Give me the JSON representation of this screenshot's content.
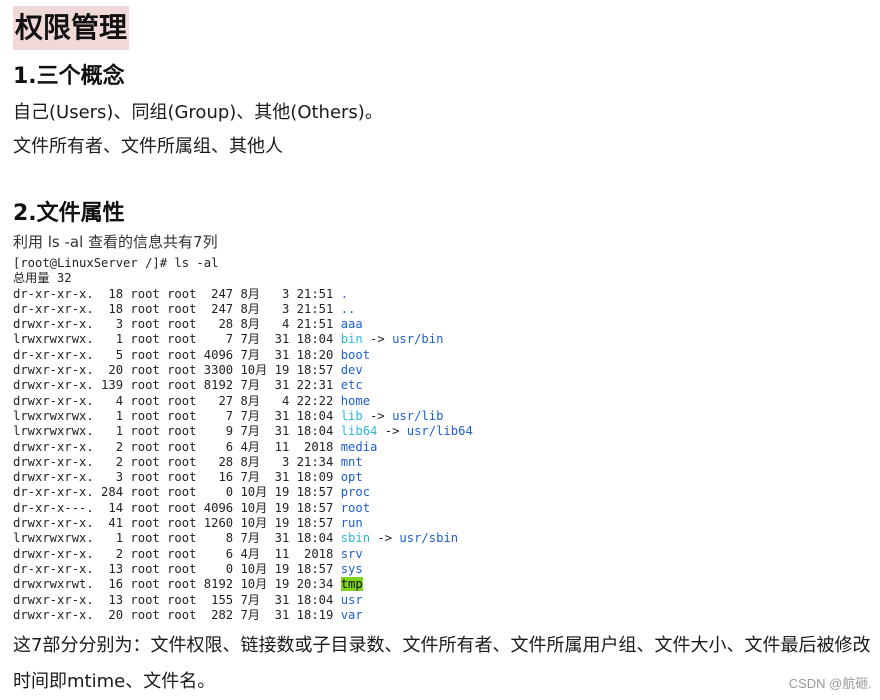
{
  "title": "权限管理",
  "section1": {
    "heading": "1.三个概念",
    "line1": "自己(Users)、同组(Group)、其他(Others)。",
    "line2": "文件所有者、文件所属组、其他人"
  },
  "section2": {
    "heading": "2.文件属性",
    "intro": "利用 ls -al 查看的信息共有7列"
  },
  "terminal": {
    "prompt": "[root@LinuxServer /]# ls -al",
    "total": "总用量 32",
    "rows": [
      {
        "perm": "dr-xr-xr-x.",
        "links": "18",
        "owner": "root",
        "group": "root",
        "size": "247",
        "month": "8月",
        "day": "3",
        "time": "21:51",
        "name": ".",
        "kind": "dir",
        "target": ""
      },
      {
        "perm": "dr-xr-xr-x.",
        "links": "18",
        "owner": "root",
        "group": "root",
        "size": "247",
        "month": "8月",
        "day": "3",
        "time": "21:51",
        "name": "..",
        "kind": "dir",
        "target": ""
      },
      {
        "perm": "drwxr-xr-x.",
        "links": "3",
        "owner": "root",
        "group": "root",
        "size": "28",
        "month": "8月",
        "day": "4",
        "time": "21:51",
        "name": "aaa",
        "kind": "dir",
        "target": ""
      },
      {
        "perm": "lrwxrwxrwx.",
        "links": "1",
        "owner": "root",
        "group": "root",
        "size": "7",
        "month": "7月",
        "day": "31",
        "time": "18:04",
        "name": "bin",
        "kind": "link",
        "target": "usr/bin"
      },
      {
        "perm": "dr-xr-xr-x.",
        "links": "5",
        "owner": "root",
        "group": "root",
        "size": "4096",
        "month": "7月",
        "day": "31",
        "time": "18:20",
        "name": "boot",
        "kind": "dir",
        "target": ""
      },
      {
        "perm": "drwxr-xr-x.",
        "links": "20",
        "owner": "root",
        "group": "root",
        "size": "3300",
        "month": "10月",
        "day": "19",
        "time": "18:57",
        "name": "dev",
        "kind": "dir",
        "target": ""
      },
      {
        "perm": "drwxr-xr-x.",
        "links": "139",
        "owner": "root",
        "group": "root",
        "size": "8192",
        "month": "7月",
        "day": "31",
        "time": "22:31",
        "name": "etc",
        "kind": "dir",
        "target": ""
      },
      {
        "perm": "drwxr-xr-x.",
        "links": "4",
        "owner": "root",
        "group": "root",
        "size": "27",
        "month": "8月",
        "day": "4",
        "time": "22:22",
        "name": "home",
        "kind": "dir",
        "target": ""
      },
      {
        "perm": "lrwxrwxrwx.",
        "links": "1",
        "owner": "root",
        "group": "root",
        "size": "7",
        "month": "7月",
        "day": "31",
        "time": "18:04",
        "name": "lib",
        "kind": "link",
        "target": "usr/lib"
      },
      {
        "perm": "lrwxrwxrwx.",
        "links": "1",
        "owner": "root",
        "group": "root",
        "size": "9",
        "month": "7月",
        "day": "31",
        "time": "18:04",
        "name": "lib64",
        "kind": "link",
        "target": "usr/lib64"
      },
      {
        "perm": "drwxr-xr-x.",
        "links": "2",
        "owner": "root",
        "group": "root",
        "size": "6",
        "month": "4月",
        "day": "11",
        "time": "2018",
        "name": "media",
        "kind": "dir",
        "target": ""
      },
      {
        "perm": "drwxr-xr-x.",
        "links": "2",
        "owner": "root",
        "group": "root",
        "size": "28",
        "month": "8月",
        "day": "3",
        "time": "21:34",
        "name": "mnt",
        "kind": "dir",
        "target": ""
      },
      {
        "perm": "drwxr-xr-x.",
        "links": "3",
        "owner": "root",
        "group": "root",
        "size": "16",
        "month": "7月",
        "day": "31",
        "time": "18:09",
        "name": "opt",
        "kind": "dir",
        "target": ""
      },
      {
        "perm": "dr-xr-xr-x.",
        "links": "284",
        "owner": "root",
        "group": "root",
        "size": "0",
        "month": "10月",
        "day": "19",
        "time": "18:57",
        "name": "proc",
        "kind": "dir",
        "target": ""
      },
      {
        "perm": "dr-xr-x---.",
        "links": "14",
        "owner": "root",
        "group": "root",
        "size": "4096",
        "month": "10月",
        "day": "19",
        "time": "18:57",
        "name": "root",
        "kind": "dir",
        "target": ""
      },
      {
        "perm": "drwxr-xr-x.",
        "links": "41",
        "owner": "root",
        "group": "root",
        "size": "1260",
        "month": "10月",
        "day": "19",
        "time": "18:57",
        "name": "run",
        "kind": "dir",
        "target": ""
      },
      {
        "perm": "lrwxrwxrwx.",
        "links": "1",
        "owner": "root",
        "group": "root",
        "size": "8",
        "month": "7月",
        "day": "31",
        "time": "18:04",
        "name": "sbin",
        "kind": "link",
        "target": "usr/sbin"
      },
      {
        "perm": "drwxr-xr-x.",
        "links": "2",
        "owner": "root",
        "group": "root",
        "size": "6",
        "month": "4月",
        "day": "11",
        "time": "2018",
        "name": "srv",
        "kind": "dir",
        "target": ""
      },
      {
        "perm": "dr-xr-xr-x.",
        "links": "13",
        "owner": "root",
        "group": "root",
        "size": "0",
        "month": "10月",
        "day": "19",
        "time": "18:57",
        "name": "sys",
        "kind": "dir",
        "target": ""
      },
      {
        "perm": "drwxrwxrwt.",
        "links": "16",
        "owner": "root",
        "group": "root",
        "size": "8192",
        "month": "10月",
        "day": "19",
        "time": "20:34",
        "name": "tmp",
        "kind": "hl",
        "target": ""
      },
      {
        "perm": "drwxr-xr-x.",
        "links": "13",
        "owner": "root",
        "group": "root",
        "size": "155",
        "month": "7月",
        "day": "31",
        "time": "18:04",
        "name": "usr",
        "kind": "dir",
        "target": ""
      },
      {
        "perm": "drwxr-xr-x.",
        "links": "20",
        "owner": "root",
        "group": "root",
        "size": "282",
        "month": "7月",
        "day": "31",
        "time": "18:19",
        "name": "var",
        "kind": "dir",
        "target": ""
      }
    ]
  },
  "summary": "这7部分分别为：文件权限、链接数或子目录数、文件所有者、文件所属用户组、文件大小、文件最后被修改时间即mtime、文件名。",
  "watermark": "CSDN @航砸."
}
